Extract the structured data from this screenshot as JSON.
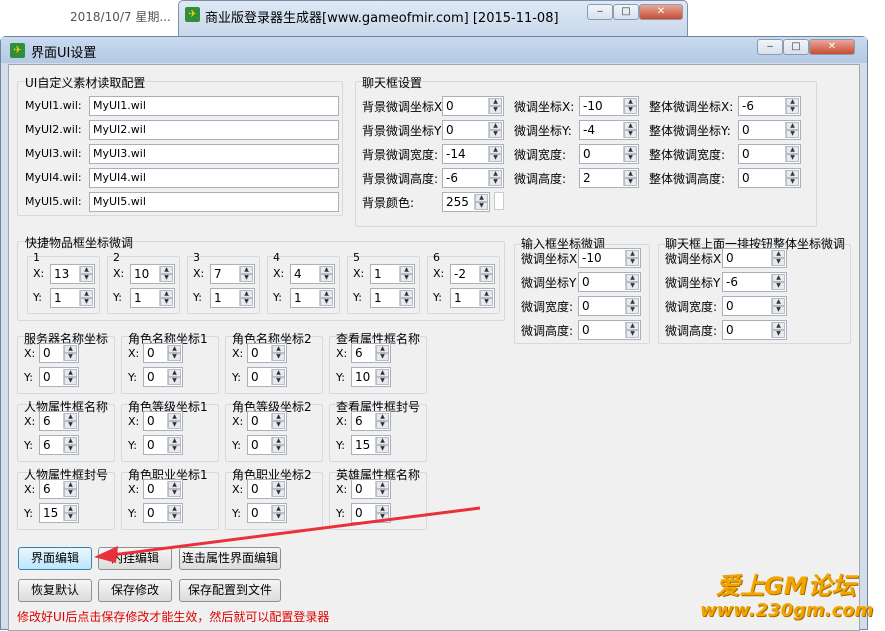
{
  "bg": {
    "dates": [
      "2018/10/7 星期..."
    ],
    "title": "商业版登录器生成器[www.gameofmir.com] [2015-11-08]"
  },
  "win": {
    "title": "界面UI设置"
  },
  "ui_group": {
    "title": "UI自定义素材读取配置",
    "rows": [
      {
        "label": "MyUI1.wil:",
        "value": "MyUI1.wil"
      },
      {
        "label": "MyUI2.wil:",
        "value": "MyUI2.wil"
      },
      {
        "label": "MyUI3.wil:",
        "value": "MyUI3.wil"
      },
      {
        "label": "MyUI4.wil:",
        "value": "MyUI4.wil"
      },
      {
        "label": "MyUI5.wil:",
        "value": "MyUI5.wil"
      }
    ]
  },
  "chat": {
    "title": "聊天框设置",
    "col1": [
      {
        "label": "背景微调坐标X",
        "value": "0"
      },
      {
        "label": "背景微调坐标Y",
        "value": "0"
      },
      {
        "label": "背景微调宽度:",
        "value": "-14"
      },
      {
        "label": "背景微调高度:",
        "value": "-6"
      }
    ],
    "col2": [
      {
        "label": "微调坐标X:",
        "value": "-10"
      },
      {
        "label": "微调坐标Y:",
        "value": "-4"
      },
      {
        "label": "微调宽度:",
        "value": "0"
      },
      {
        "label": "微调高度:",
        "value": "2"
      }
    ],
    "col3": [
      {
        "label": "整体微调坐标X:",
        "value": "-6"
      },
      {
        "label": "整体微调坐标Y:",
        "value": "0"
      },
      {
        "label": "整体微调宽度:",
        "value": "0"
      },
      {
        "label": "整体微调高度:",
        "value": "0"
      }
    ],
    "color_label": "背景颜色:",
    "color_value": "255"
  },
  "quick": {
    "title": "快捷物品框坐标微调",
    "slots": [
      {
        "n": "1",
        "x": "13",
        "y": "1"
      },
      {
        "n": "2",
        "x": "10",
        "y": "1"
      },
      {
        "n": "3",
        "x": "7",
        "y": "1"
      },
      {
        "n": "4",
        "x": "4",
        "y": "1"
      },
      {
        "n": "5",
        "x": "1",
        "y": "1"
      },
      {
        "n": "6",
        "x": "-2",
        "y": "1"
      }
    ]
  },
  "input": {
    "title": "输入框坐标微调",
    "rows": [
      {
        "label": "微调坐标X",
        "value": "-10"
      },
      {
        "label": "微调坐标Y",
        "value": "0"
      },
      {
        "label": "微调宽度:",
        "value": "0"
      },
      {
        "label": "微调高度:",
        "value": "0"
      }
    ]
  },
  "chatbtns": {
    "title": "聊天框上面一排按钮整体坐标微调",
    "rows": [
      {
        "label": "微调坐标X",
        "value": "0"
      },
      {
        "label": "微调坐标Y",
        "value": "-6"
      },
      {
        "label": "微调宽度:",
        "value": "0"
      },
      {
        "label": "微调高度:",
        "value": "0"
      }
    ]
  },
  "coords": [
    {
      "title": "服务器名称坐标",
      "x": "0",
      "y": "0"
    },
    {
      "title": "角色名称坐标1",
      "x": "0",
      "y": "0"
    },
    {
      "title": "角色名称坐标2",
      "x": "0",
      "y": "0"
    },
    {
      "title": "查看属性框名称",
      "x": "6",
      "y": "10"
    },
    {
      "title": "人物属性框名称",
      "x": "6",
      "y": "6"
    },
    {
      "title": "角色等级坐标1",
      "x": "0",
      "y": "0"
    },
    {
      "title": "角色等级坐标2",
      "x": "0",
      "y": "0"
    },
    {
      "title": "查看属性框封号",
      "x": "6",
      "y": "15"
    },
    {
      "title": "人物属性框封号",
      "x": "6",
      "y": "15"
    },
    {
      "title": "角色职业坐标1",
      "x": "0",
      "y": "0"
    },
    {
      "title": "角色职业坐标2",
      "x": "0",
      "y": "0"
    },
    {
      "title": "英雄属性框名称",
      "x": "0",
      "y": "0"
    }
  ],
  "axis": {
    "x": "X:",
    "y": "Y:"
  },
  "buttons": {
    "ui_edit": "界面编辑",
    "plugin_edit": "内挂编辑",
    "attr_edit": "连击属性界面编辑",
    "reset": "恢复默认",
    "save": "保存修改",
    "save_file": "保存配置到文件"
  },
  "note": "修改好UI后点击保存修改才能生效，然后就可以配置登录器",
  "watermark": {
    "line1": "爱上GM论坛",
    "line2": "www.230gm.com"
  },
  "colors": {
    "arrow": "#e8313a",
    "note": "#e00000",
    "watermark": "#f2a500"
  }
}
